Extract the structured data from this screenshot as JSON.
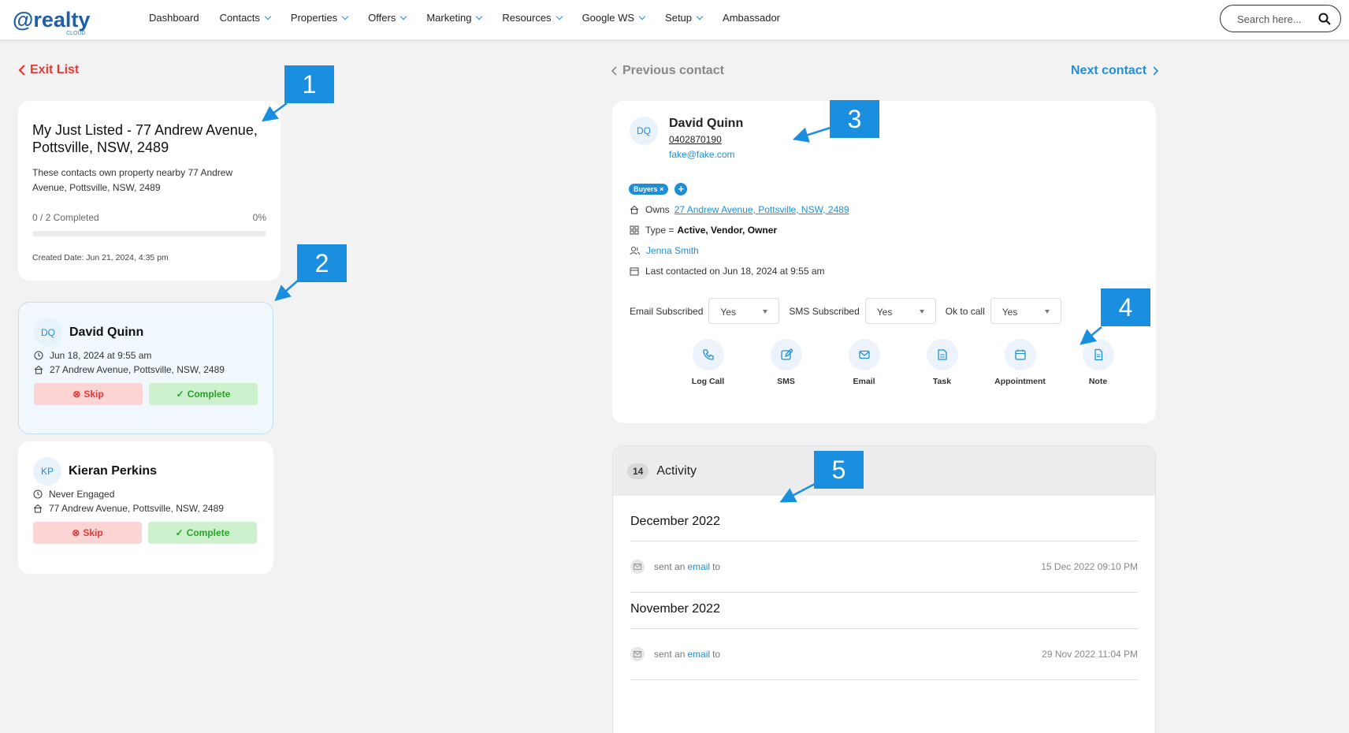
{
  "logo": {
    "text": "@realty",
    "sub": "CLOUD"
  },
  "nav": [
    {
      "label": "Dashboard",
      "dd": false
    },
    {
      "label": "Contacts",
      "dd": true
    },
    {
      "label": "Properties",
      "dd": true
    },
    {
      "label": "Offers",
      "dd": true
    },
    {
      "label": "Marketing",
      "dd": true
    },
    {
      "label": "Resources",
      "dd": true
    },
    {
      "label": "Google WS",
      "dd": true
    },
    {
      "label": "Setup",
      "dd": true
    },
    {
      "label": "Ambassador",
      "dd": false
    }
  ],
  "search": {
    "placeholder": "Search here..."
  },
  "exit_label": "Exit List",
  "list": {
    "title": "My Just Listed - 77 Andrew Avenue, Pottsville, NSW, 2489",
    "description": "These contacts own property nearby 77 Andrew Avenue, Pottsville, NSW, 2489",
    "completed": "0 / 2 Completed",
    "percent": "0%",
    "progress": 0,
    "created": "Created Date: Jun 21, 2024, 4:35 pm"
  },
  "contacts": [
    {
      "initials": "DQ",
      "name": "David Quinn",
      "when": "Jun 18, 2024 at 9:55 am",
      "address": "27 Andrew Avenue, Pottsville, NSW, 2489",
      "skip": "Skip",
      "complete": "Complete"
    },
    {
      "initials": "KP",
      "name": "Kieran Perkins",
      "when": "Never Engaged",
      "address": "77 Andrew Avenue, Pottsville, NSW, 2489",
      "skip": "Skip",
      "complete": "Complete"
    }
  ],
  "prev_label": "Previous contact",
  "next_label": "Next contact",
  "contact": {
    "initials": "DQ",
    "name": "David Quinn",
    "phone": "0402870190",
    "email": "fake@fake.com",
    "tag": "Buyers",
    "owns_label": "Owns",
    "owns_address": "27 Andrew Avenue, Pottsville, NSW, 2489",
    "type_label": "Type = ",
    "type_value": "Active, Vendor, Owner",
    "agent": "Jenna Smith",
    "last_contacted": "Last contacted on Jun 18, 2024 at 9:55 am"
  },
  "subs": [
    {
      "label": "Email Subscribed",
      "value": "Yes"
    },
    {
      "label": "SMS Subscribed",
      "value": "Yes"
    },
    {
      "label": "Ok to call",
      "value": "Yes"
    }
  ],
  "actions": [
    {
      "label": "Log Call",
      "icon": "phone-icon"
    },
    {
      "label": "SMS",
      "icon": "edit-icon"
    },
    {
      "label": "Email",
      "icon": "mail-icon"
    },
    {
      "label": "Task",
      "icon": "task-icon"
    },
    {
      "label": "Appointment",
      "icon": "calendar-icon"
    },
    {
      "label": "Note",
      "icon": "note-icon"
    }
  ],
  "activity": {
    "count": "14",
    "title": "Activity",
    "groups": [
      {
        "month": "December 2022",
        "events": [
          {
            "pre": "sent an",
            "link": "email",
            "post": "to",
            "date": "15 Dec 2022 09:10 PM"
          }
        ]
      },
      {
        "month": "November 2022",
        "events": [
          {
            "pre": "sent an",
            "link": "email",
            "post": "to",
            "date": "29 Nov 2022 11:04 PM"
          }
        ]
      }
    ]
  },
  "callouts": [
    "1",
    "2",
    "3",
    "4",
    "5"
  ],
  "colors": {
    "accent": "#1e8fd6",
    "danger": "#e53935",
    "success": "#2ca02c",
    "callout": "#1a8fe0"
  }
}
